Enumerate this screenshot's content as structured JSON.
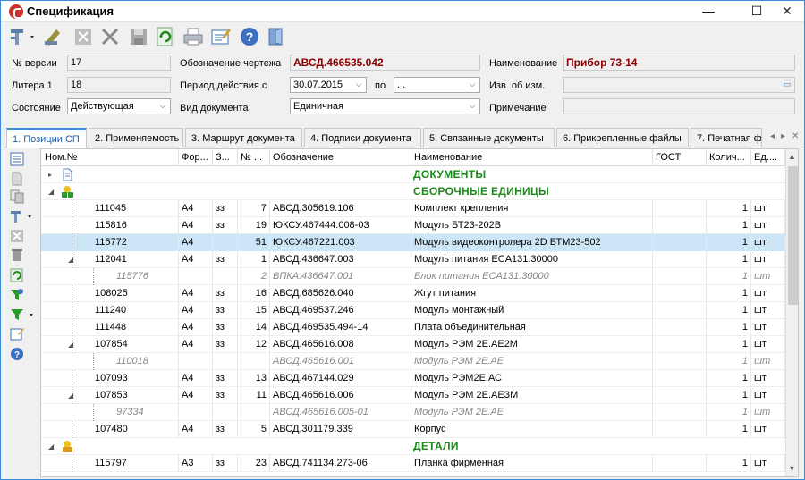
{
  "window": {
    "title": "Спецификация",
    "minimize": "—",
    "maximize": "☐",
    "close": "✕"
  },
  "toolbar": {
    "buttons": [
      "tools-dropdown",
      "edit",
      "cancel",
      "delete",
      "save",
      "refresh",
      "print",
      "report",
      "help",
      "exit"
    ]
  },
  "form": {
    "version_label": "№ версии",
    "version_value": "17",
    "drawing_label": "Обозначение чертежа",
    "drawing_value": "АВСД.466535.042",
    "name_label": "Наименование",
    "name_value": "Прибор 73-14",
    "litera_label": "Литера 1",
    "litera_value": "18",
    "period_label": "Период действия с",
    "period_from": "30.07.2015",
    "period_to_label": "по",
    "period_to": ". .",
    "change_label": "Изв. об изм.",
    "change_value": "",
    "state_label": "Состояние",
    "state_value": "Действующая",
    "doctype_label": "Вид документа",
    "doctype_value": "Единичная",
    "note_label": "Примечание",
    "note_value": ""
  },
  "tabs": [
    "1. Позиции СП",
    "2. Применяемость",
    "3. Маршрут документа",
    "4. Подписи документа",
    "5. Связанные документы",
    "6. Прикрепленные файлы",
    "7. Печатная ф"
  ],
  "grid": {
    "columns": [
      "Ном.№",
      "Фор...",
      "З...",
      "№ ...",
      "Обозначение",
      "Наименование",
      "ГОСТ",
      "Колич...",
      "Ед...."
    ],
    "sections": {
      "docs": "ДОКУМЕНТЫ",
      "asm": "СБОРОЧНЫЕ ЕДИНИЦЫ",
      "parts": "ДЕТАЛИ"
    },
    "rows": [
      {
        "num": "111045",
        "fmt": "А4",
        "z": "зз",
        "pos": "7",
        "des": "АВСД.305619.106",
        "name": "Комплект крепления",
        "qty": "1",
        "unit": "шт"
      },
      {
        "num": "115816",
        "fmt": "А4",
        "z": "зз",
        "pos": "19",
        "des": "ЮКСУ.467444.008-03",
        "name": "Модуль БТ23-202В",
        "qty": "1",
        "unit": "шт"
      },
      {
        "num": "115772",
        "fmt": "А4",
        "z": "",
        "pos": "51",
        "des": "ЮКСУ.467221.003",
        "name": "Модуль видеоконтролера 2D БТМ23-502",
        "qty": "1",
        "unit": "шт"
      },
      {
        "num": "112041",
        "fmt": "А4",
        "z": "зз",
        "pos": "1",
        "des": "АВСД.436647.003",
        "name": "Модуль питания ECA131.30000",
        "qty": "1",
        "unit": "шт"
      },
      {
        "num": "115776",
        "fmt": "",
        "z": "",
        "pos": "2",
        "des": "ВПКА.436647.001",
        "name": "Блок питания ECA131.30000",
        "qty": "1",
        "unit": "шт"
      },
      {
        "num": "108025",
        "fmt": "А4",
        "z": "зз",
        "pos": "16",
        "des": "АВСД.685626.040",
        "name": "Жгут питания",
        "qty": "1",
        "unit": "шт"
      },
      {
        "num": "111240",
        "fmt": "А4",
        "z": "зз",
        "pos": "15",
        "des": "АВСД.469537.246",
        "name": "Модуль монтажный",
        "qty": "1",
        "unit": "шт"
      },
      {
        "num": "111448",
        "fmt": "А4",
        "z": "зз",
        "pos": "14",
        "des": "АВСД.469535.494-14",
        "name": "Плата объединительная",
        "qty": "1",
        "unit": "шт"
      },
      {
        "num": "107854",
        "fmt": "А4",
        "z": "зз",
        "pos": "12",
        "des": "АВСД.465616.008",
        "name": "Модуль РЭМ 2Е.АЕ2М",
        "qty": "1",
        "unit": "шт"
      },
      {
        "num": "110018",
        "fmt": "",
        "z": "",
        "pos": "",
        "des": "АВСД.465616.001",
        "name": "Модуль РЭМ 2Е.АЕ",
        "qty": "1",
        "unit": "шт"
      },
      {
        "num": "107093",
        "fmt": "А4",
        "z": "зз",
        "pos": "13",
        "des": "АВСД.467144.029",
        "name": "Модуль РЭМ2Е.АС",
        "qty": "1",
        "unit": "шт"
      },
      {
        "num": "107853",
        "fmt": "А4",
        "z": "зз",
        "pos": "11",
        "des": "АВСД.465616.006",
        "name": "Модуль РЭМ 2Е.АЕЗМ",
        "qty": "1",
        "unit": "шт"
      },
      {
        "num": "97334",
        "fmt": "",
        "z": "",
        "pos": "",
        "des": "АВСД.465616.005-01",
        "name": "Модуль РЭМ 2Е.АЕ",
        "qty": "1",
        "unit": "шт"
      },
      {
        "num": "107480",
        "fmt": "А4",
        "z": "зз",
        "pos": "5",
        "des": "АВСД.301179.339",
        "name": "Корпус",
        "qty": "1",
        "unit": "шт"
      },
      {
        "num": "115797",
        "fmt": "А3",
        "z": "зз",
        "pos": "23",
        "des": "АВСД.741134.273-06",
        "name": "Планка фирменная",
        "qty": "1",
        "unit": "шт"
      }
    ]
  }
}
